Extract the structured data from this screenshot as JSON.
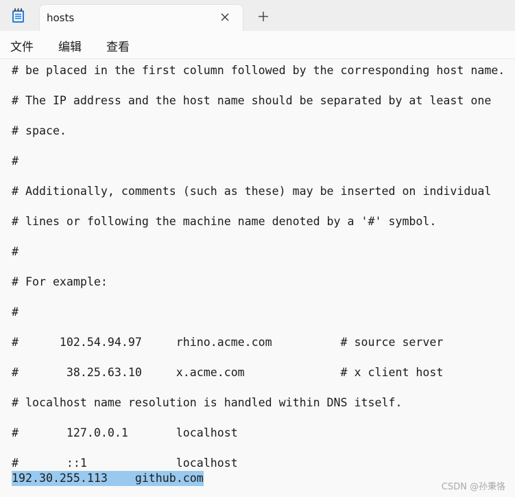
{
  "window": {
    "tab_title": "hosts",
    "new_tab_symbol": "+",
    "close_icon": "close-icon",
    "app_icon": "notepad-icon"
  },
  "menu": {
    "items": [
      "文件",
      "编辑",
      "查看"
    ]
  },
  "editor": {
    "lines": [
      "# be placed in the first column followed by the corresponding host name.",
      "# The IP address and the host name should be separated by at least one",
      "# space.",
      "#",
      "# Additionally, comments (such as these) may be inserted on individual",
      "# lines or following the machine name denoted by a '#' symbol.",
      "#",
      "# For example:",
      "#",
      "#      102.54.94.97     rhino.acme.com          # source server",
      "#       38.25.63.10     x.acme.com              # x client host",
      "# localhost name resolution is handled within DNS itself.",
      "#       127.0.0.1       localhost",
      "#       ::1             localhost"
    ],
    "selected_line": "192.30.255.113    github.com"
  },
  "watermark": "CSDN @孙秉恪",
  "colors": {
    "background": "#f9f9f9",
    "titlebar": "#eeeeee",
    "selection": "#99c9ef",
    "text": "#1c1c1c"
  }
}
